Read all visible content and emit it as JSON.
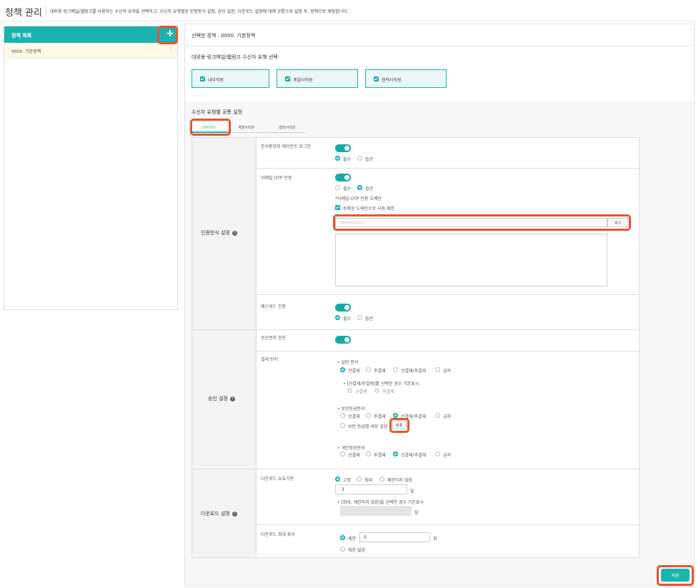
{
  "header": {
    "title": "정책 관리",
    "desc": "대외용·링크메일/웹링크를 사용하는 수신자 유형을 선택하고, 수신자 유형별로 인증방식 설정, 승인 설정, 다운로드 설정에 대해 공통으로 설정 후, 정책으로 세팅합니다."
  },
  "sidebar": {
    "title": "정책 목록",
    "add": "+",
    "items": [
      {
        "label": "0000. 기본정책",
        "more": "⋮"
      }
    ]
  },
  "main": {
    "selected": "선택한 정책 : 0000. 기본정책",
    "recipient_title": "대외용·링크메일/웹링크 수신자 유형 선택",
    "recipients": [
      {
        "label": "내부직원"
      },
      {
        "label": "계열사직원"
      },
      {
        "label": "협력사직원"
      }
    ],
    "common_title": "수신자 유형별 공통 설정",
    "tabs": [
      {
        "label": "내부직원"
      },
      {
        "label": "계열사직원"
      },
      {
        "label": "협력사직원"
      }
    ],
    "auth": {
      "section": "인증방식 설정",
      "sso": {
        "label": "문서중앙화 에이전트 로그인",
        "opt1": "필수",
        "opt2": "옵션"
      },
      "otp": {
        "label": "이메일 OTP 인증",
        "opt1": "필수",
        "opt2": "옵션",
        "domain_label": "*이메일 OTP 인증 도메인",
        "restrict": "등록된 도메인으로 사용 제한",
        "placeholder": "cloudsec.com",
        "add": "추가"
      },
      "pw": {
        "label": "패스워드 인증",
        "opt1": "필수",
        "opt2": "옵션"
      }
    },
    "approval": {
      "section": "승인 설정",
      "approver": "승인권자 승인",
      "method": "결재 방식",
      "general": {
        "title": "• 일반 문서",
        "opts": [
          "선결재",
          "후결재",
          "선결재/후결재",
          "금지"
        ]
      },
      "note": "• [선결재/후결재]를 선택한 경우 기본표시",
      "note_opts": [
        "선결재",
        "후결재"
      ],
      "security": {
        "title": "• 보안등급문서",
        "opts": [
          "선결재",
          "후결재",
          "선결재/후결재",
          "금지"
        ]
      },
      "detail": "보안 등급별 세부 설정",
      "detail_btn": "변경",
      "privacy": {
        "title": "• 개인정보문서",
        "opts": [
          "선결재",
          "후결재",
          "선결재/후결재",
          "금지"
        ]
      }
    },
    "download": {
      "section": "다운로드 설정",
      "period": {
        "label": "다운로드 유효기한",
        "opts": [
          "고정",
          "최대",
          "제한하지 않음"
        ],
        "value": "3",
        "unit": "일",
        "note": "• [최대, 제한하지 않음]을 선택한 경우 기본표시",
        "unit2": "일"
      },
      "count": {
        "label": "다운로드 최대 횟수",
        "opt1": "제한",
        "value": "5",
        "unit": "회",
        "opt2": "제한 없음"
      }
    },
    "apply": "적용"
  }
}
